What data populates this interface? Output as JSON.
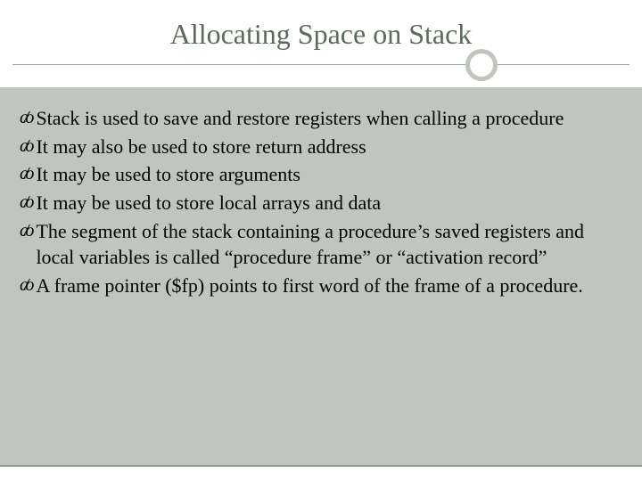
{
  "title": "Allocating Space on Stack",
  "bullets": [
    {
      "text": "Stack is used to save and restore registers when calling a procedure"
    },
    {
      "text": "It may also be used to store return address"
    },
    {
      "text": "It may be used to store arguments"
    },
    {
      "text": "It may be used to store local arrays and data"
    },
    {
      "text": "The segment of the stack containing a procedure’s saved registers and local variables is called “procedure frame” or “activation record”"
    },
    {
      "text": "A frame pointer ($fp) points to first word of the frame of a procedure."
    }
  ],
  "colors": {
    "background": "#c0c6bd",
    "headerBg": "#ffffff",
    "titleColor": "#5a6b5a",
    "ruleColor": "#9aa69a",
    "textColor": "#000000"
  }
}
